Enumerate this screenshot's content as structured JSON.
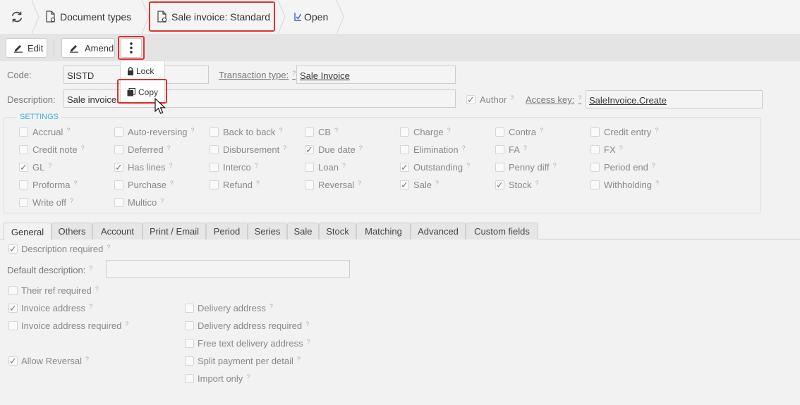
{
  "breadcrumb": {
    "document_types": "Document types",
    "current": "Sale invoice: Standard",
    "status": "Open"
  },
  "toolbar": {
    "edit": "Edit",
    "amend": "Amend"
  },
  "menu": {
    "lock": "Lock",
    "copy": "Copy"
  },
  "form": {
    "code_label": "Code:",
    "code_value": "SISTD",
    "transaction_type_label": "Transaction type:",
    "transaction_type_value": "Sale Invoice",
    "description_label": "Description:",
    "description_value": "Sale invoice:",
    "author_label": "Author",
    "access_key_label": "Access key:",
    "access_key_value": "SaleInvoice.Create",
    "help": "?"
  },
  "settings": {
    "title": "SETTINGS",
    "items": [
      {
        "label": "Accrual",
        "checked": false
      },
      {
        "label": "Auto-reversing",
        "checked": false
      },
      {
        "label": "Back to back",
        "checked": false
      },
      {
        "label": "CB",
        "checked": false
      },
      {
        "label": "Charge",
        "checked": false
      },
      {
        "label": "Contra",
        "checked": false
      },
      {
        "label": "Credit entry",
        "checked": false
      },
      {
        "label": "Credit note",
        "checked": false
      },
      {
        "label": "Deferred",
        "checked": false
      },
      {
        "label": "Disbursement",
        "checked": false
      },
      {
        "label": "Due date",
        "checked": true
      },
      {
        "label": "Elimination",
        "checked": false
      },
      {
        "label": "FA",
        "checked": false
      },
      {
        "label": "FX",
        "checked": false
      },
      {
        "label": "GL",
        "checked": true
      },
      {
        "label": "Has lines",
        "checked": true
      },
      {
        "label": "Interco",
        "checked": false
      },
      {
        "label": "Loan",
        "checked": false
      },
      {
        "label": "Outstanding",
        "checked": true
      },
      {
        "label": "Penny diff",
        "checked": false
      },
      {
        "label": "Period end",
        "checked": false
      },
      {
        "label": "Proforma",
        "checked": false
      },
      {
        "label": "Purchase",
        "checked": false
      },
      {
        "label": "Refund",
        "checked": false
      },
      {
        "label": "Reversal",
        "checked": false
      },
      {
        "label": "Sale",
        "checked": true
      },
      {
        "label": "Stock",
        "checked": true
      },
      {
        "label": "Withholding",
        "checked": false
      },
      {
        "label": "Write off",
        "checked": false
      },
      {
        "label": "Multico",
        "checked": false
      }
    ]
  },
  "tabs": [
    "General",
    "Others",
    "Account",
    "Print / Email",
    "Period",
    "Series",
    "Sale",
    "Stock",
    "Matching",
    "Advanced",
    "Custom fields"
  ],
  "general": {
    "description_required": {
      "label": "Description required",
      "checked": true
    },
    "default_description_label": "Default description:",
    "default_description_value": "",
    "their_ref_required": {
      "label": "Their ref required",
      "checked": false
    },
    "invoice_address": {
      "label": "Invoice address",
      "checked": true
    },
    "invoice_address_required": {
      "label": "Invoice address required",
      "checked": false
    },
    "allow_reversal": {
      "label": "Allow Reversal",
      "checked": true
    },
    "delivery_address": {
      "label": "Delivery address",
      "checked": false
    },
    "delivery_address_required": {
      "label": "Delivery address required",
      "checked": false
    },
    "free_text_delivery_address": {
      "label": "Free text delivery address",
      "checked": false
    },
    "split_payment_per_detail": {
      "label": "Split payment per detail",
      "checked": false
    },
    "import_only": {
      "label": "Import only",
      "checked": false
    }
  },
  "colors": {
    "highlight": "#e0322f",
    "accent": "#3ab0d4",
    "help": "#b5a3c9"
  }
}
